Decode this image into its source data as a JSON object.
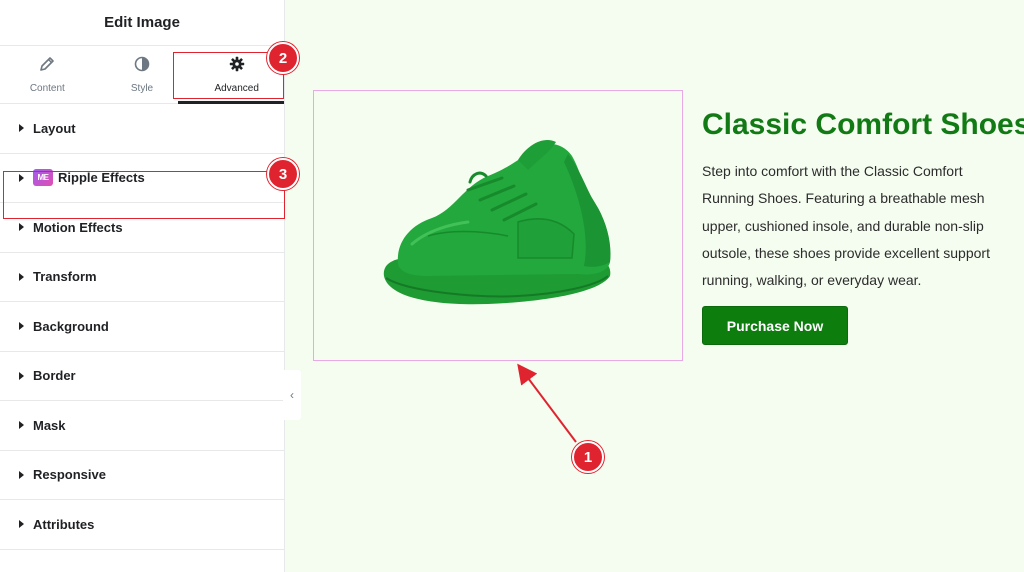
{
  "sidebar": {
    "title": "Edit Image",
    "tabs": [
      {
        "label": "Content",
        "icon": "pencil-icon"
      },
      {
        "label": "Style",
        "icon": "half-circle-icon"
      },
      {
        "label": "Advanced",
        "icon": "gear-icon"
      }
    ],
    "active_tab": "Advanced",
    "sections": [
      {
        "label": "Layout"
      },
      {
        "label": "Ripple Effects",
        "badge": "ME"
      },
      {
        "label": "Motion Effects"
      },
      {
        "label": "Transform"
      },
      {
        "label": "Background"
      },
      {
        "label": "Border"
      },
      {
        "label": "Mask"
      },
      {
        "label": "Responsive"
      },
      {
        "label": "Attributes"
      }
    ],
    "collapse_icon": "‹"
  },
  "product": {
    "title": "Classic Comfort Shoes",
    "description_lines": [
      "Step into comfort with the Classic Comfort",
      "Running Shoes. Featuring a breathable mesh",
      "upper, cushioned insole, and durable non-slip",
      "outsole, these shoes provide excellent support",
      "running, walking, or everyday wear."
    ],
    "button_label": "Purchase Now",
    "image_icon": "green-sneaker-image"
  },
  "annotations": {
    "badge_1": "1",
    "badge_2": "2",
    "badge_3": "3"
  },
  "colors": {
    "accent_red": "#e0242f",
    "title_green": "#127a15",
    "button_green": "#0d7d0e",
    "canvas_bg": "#f5fdf0",
    "frame_pink": "#e9a9e6"
  }
}
